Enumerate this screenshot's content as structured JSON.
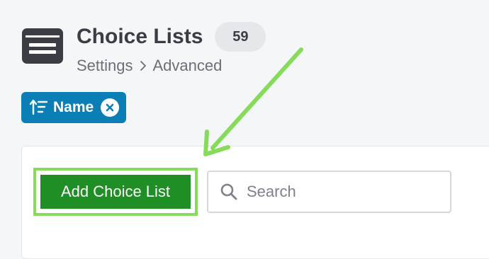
{
  "page": {
    "title": "Choice Lists",
    "count": "59"
  },
  "breadcrumb": {
    "items": [
      "Settings",
      "Advanced"
    ]
  },
  "filter_chip": {
    "label": "Name"
  },
  "toolbar": {
    "add_button_label": "Add Choice List",
    "search_placeholder": "Search",
    "search_value": ""
  },
  "colors": {
    "background": "#f5f6f8",
    "title_text": "#3c3c44",
    "chip_blue": "#0b7fb5",
    "button_green": "#1f8e24",
    "annotation_green": "#86dc5a"
  },
  "icons": {
    "header": "choice-list-icon",
    "chip_sort": "sort-ascending-icon",
    "chip_remove": "close-icon",
    "breadcrumb_separator": "chevron-right-icon",
    "search": "search-icon"
  }
}
